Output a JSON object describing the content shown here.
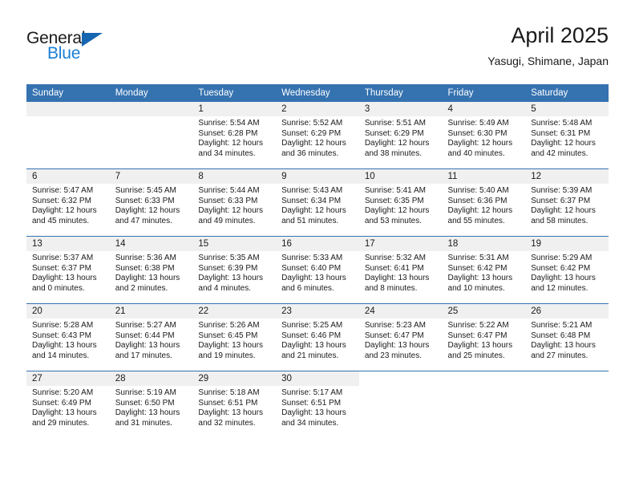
{
  "brand": {
    "name_part1": "General",
    "name_part2": "Blue",
    "triangle_color": "#1565b0",
    "blue_text_color": "#1b7fd4"
  },
  "header": {
    "title": "April 2025",
    "subtitle": "Yasugi, Shimane, Japan"
  },
  "theme": {
    "header_blue": "#3572b0",
    "daynum_band": "#f0f0f0",
    "text": "#1a1a1a"
  },
  "weekday_headers": [
    "Sunday",
    "Monday",
    "Tuesday",
    "Wednesday",
    "Thursday",
    "Friday",
    "Saturday"
  ],
  "weeks": [
    [
      {
        "day": "",
        "lines": []
      },
      {
        "day": "",
        "lines": []
      },
      {
        "day": "1",
        "lines": [
          "Sunrise: 5:54 AM",
          "Sunset: 6:28 PM",
          "Daylight: 12 hours",
          "and 34 minutes."
        ]
      },
      {
        "day": "2",
        "lines": [
          "Sunrise: 5:52 AM",
          "Sunset: 6:29 PM",
          "Daylight: 12 hours",
          "and 36 minutes."
        ]
      },
      {
        "day": "3",
        "lines": [
          "Sunrise: 5:51 AM",
          "Sunset: 6:29 PM",
          "Daylight: 12 hours",
          "and 38 minutes."
        ]
      },
      {
        "day": "4",
        "lines": [
          "Sunrise: 5:49 AM",
          "Sunset: 6:30 PM",
          "Daylight: 12 hours",
          "and 40 minutes."
        ]
      },
      {
        "day": "5",
        "lines": [
          "Sunrise: 5:48 AM",
          "Sunset: 6:31 PM",
          "Daylight: 12 hours",
          "and 42 minutes."
        ]
      }
    ],
    [
      {
        "day": "6",
        "lines": [
          "Sunrise: 5:47 AM",
          "Sunset: 6:32 PM",
          "Daylight: 12 hours",
          "and 45 minutes."
        ]
      },
      {
        "day": "7",
        "lines": [
          "Sunrise: 5:45 AM",
          "Sunset: 6:33 PM",
          "Daylight: 12 hours",
          "and 47 minutes."
        ]
      },
      {
        "day": "8",
        "lines": [
          "Sunrise: 5:44 AM",
          "Sunset: 6:33 PM",
          "Daylight: 12 hours",
          "and 49 minutes."
        ]
      },
      {
        "day": "9",
        "lines": [
          "Sunrise: 5:43 AM",
          "Sunset: 6:34 PM",
          "Daylight: 12 hours",
          "and 51 minutes."
        ]
      },
      {
        "day": "10",
        "lines": [
          "Sunrise: 5:41 AM",
          "Sunset: 6:35 PM",
          "Daylight: 12 hours",
          "and 53 minutes."
        ]
      },
      {
        "day": "11",
        "lines": [
          "Sunrise: 5:40 AM",
          "Sunset: 6:36 PM",
          "Daylight: 12 hours",
          "and 55 minutes."
        ]
      },
      {
        "day": "12",
        "lines": [
          "Sunrise: 5:39 AM",
          "Sunset: 6:37 PM",
          "Daylight: 12 hours",
          "and 58 minutes."
        ]
      }
    ],
    [
      {
        "day": "13",
        "lines": [
          "Sunrise: 5:37 AM",
          "Sunset: 6:37 PM",
          "Daylight: 13 hours",
          "and 0 minutes."
        ]
      },
      {
        "day": "14",
        "lines": [
          "Sunrise: 5:36 AM",
          "Sunset: 6:38 PM",
          "Daylight: 13 hours",
          "and 2 minutes."
        ]
      },
      {
        "day": "15",
        "lines": [
          "Sunrise: 5:35 AM",
          "Sunset: 6:39 PM",
          "Daylight: 13 hours",
          "and 4 minutes."
        ]
      },
      {
        "day": "16",
        "lines": [
          "Sunrise: 5:33 AM",
          "Sunset: 6:40 PM",
          "Daylight: 13 hours",
          "and 6 minutes."
        ]
      },
      {
        "day": "17",
        "lines": [
          "Sunrise: 5:32 AM",
          "Sunset: 6:41 PM",
          "Daylight: 13 hours",
          "and 8 minutes."
        ]
      },
      {
        "day": "18",
        "lines": [
          "Sunrise: 5:31 AM",
          "Sunset: 6:42 PM",
          "Daylight: 13 hours",
          "and 10 minutes."
        ]
      },
      {
        "day": "19",
        "lines": [
          "Sunrise: 5:29 AM",
          "Sunset: 6:42 PM",
          "Daylight: 13 hours",
          "and 12 minutes."
        ]
      }
    ],
    [
      {
        "day": "20",
        "lines": [
          "Sunrise: 5:28 AM",
          "Sunset: 6:43 PM",
          "Daylight: 13 hours",
          "and 14 minutes."
        ]
      },
      {
        "day": "21",
        "lines": [
          "Sunrise: 5:27 AM",
          "Sunset: 6:44 PM",
          "Daylight: 13 hours",
          "and 17 minutes."
        ]
      },
      {
        "day": "22",
        "lines": [
          "Sunrise: 5:26 AM",
          "Sunset: 6:45 PM",
          "Daylight: 13 hours",
          "and 19 minutes."
        ]
      },
      {
        "day": "23",
        "lines": [
          "Sunrise: 5:25 AM",
          "Sunset: 6:46 PM",
          "Daylight: 13 hours",
          "and 21 minutes."
        ]
      },
      {
        "day": "24",
        "lines": [
          "Sunrise: 5:23 AM",
          "Sunset: 6:47 PM",
          "Daylight: 13 hours",
          "and 23 minutes."
        ]
      },
      {
        "day": "25",
        "lines": [
          "Sunrise: 5:22 AM",
          "Sunset: 6:47 PM",
          "Daylight: 13 hours",
          "and 25 minutes."
        ]
      },
      {
        "day": "26",
        "lines": [
          "Sunrise: 5:21 AM",
          "Sunset: 6:48 PM",
          "Daylight: 13 hours",
          "and 27 minutes."
        ]
      }
    ],
    [
      {
        "day": "27",
        "lines": [
          "Sunrise: 5:20 AM",
          "Sunset: 6:49 PM",
          "Daylight: 13 hours",
          "and 29 minutes."
        ]
      },
      {
        "day": "28",
        "lines": [
          "Sunrise: 5:19 AM",
          "Sunset: 6:50 PM",
          "Daylight: 13 hours",
          "and 31 minutes."
        ]
      },
      {
        "day": "29",
        "lines": [
          "Sunrise: 5:18 AM",
          "Sunset: 6:51 PM",
          "Daylight: 13 hours",
          "and 32 minutes."
        ]
      },
      {
        "day": "30",
        "lines": [
          "Sunrise: 5:17 AM",
          "Sunset: 6:51 PM",
          "Daylight: 13 hours",
          "and 34 minutes."
        ]
      },
      {
        "day": "",
        "lines": []
      },
      {
        "day": "",
        "lines": []
      },
      {
        "day": "",
        "lines": []
      }
    ]
  ]
}
